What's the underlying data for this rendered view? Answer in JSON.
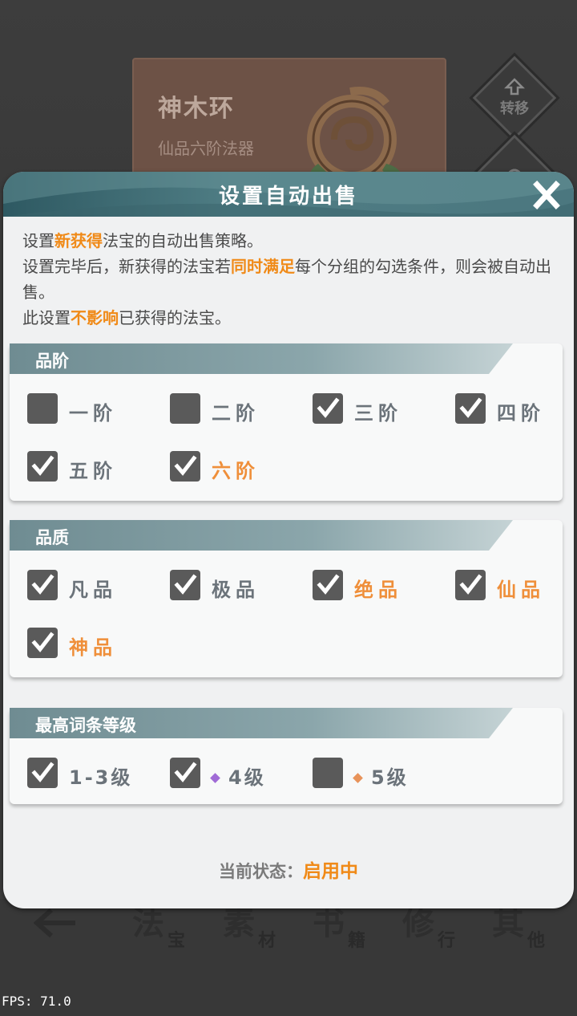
{
  "background": {
    "item_name": "神木环",
    "item_subtitle": "仙品六阶法器",
    "side_buttons": [
      {
        "label": "转移",
        "icon": "upload-icon"
      },
      {
        "label": "",
        "icon": "gear-icon"
      }
    ],
    "bottom_nav": [
      {
        "big": "法",
        "small": "宝"
      },
      {
        "big": "素",
        "small": "材"
      },
      {
        "big": "书",
        "small": "籍"
      },
      {
        "big": "修",
        "small": "行"
      },
      {
        "big": "其",
        "small": "他"
      }
    ],
    "fps_label": "FPS: 71.0"
  },
  "modal": {
    "title": "设置自动出售",
    "close_label": "X",
    "desc_line1": {
      "a": "设置",
      "hl": "新获得",
      "b": "法宝的自动出售策略。"
    },
    "desc_line2": {
      "a": "设置完毕后，新获得的法宝若",
      "hl": "同时满足",
      "b": "每个分组的勾选条件，则会被自动出售。"
    },
    "desc_line3": {
      "a": "此设置",
      "hl": "不影响",
      "b": "已获得的法宝。"
    }
  },
  "groups": {
    "tier": {
      "title": "品阶",
      "options": [
        {
          "label": "一阶",
          "checked": false,
          "orange": false
        },
        {
          "label": "二阶",
          "checked": false,
          "orange": false
        },
        {
          "label": "三阶",
          "checked": true,
          "orange": false
        },
        {
          "label": "四阶",
          "checked": true,
          "orange": false
        },
        {
          "label": "五阶",
          "checked": true,
          "orange": false
        },
        {
          "label": "六阶",
          "checked": true,
          "orange": true
        }
      ]
    },
    "quality": {
      "title": "品质",
      "options": [
        {
          "label": "凡品",
          "checked": true,
          "orange": false
        },
        {
          "label": "极品",
          "checked": true,
          "orange": false
        },
        {
          "label": "绝品",
          "checked": true,
          "orange": true
        },
        {
          "label": "仙品",
          "checked": true,
          "orange": true
        },
        {
          "label": "神品",
          "checked": true,
          "orange": true
        }
      ]
    },
    "affix": {
      "title": "最高词条等级",
      "options": [
        {
          "label": "1-3级",
          "checked": true,
          "diamond": ""
        },
        {
          "label": "4级",
          "checked": true,
          "diamond": "#a06bd6"
        },
        {
          "label": "5级",
          "checked": false,
          "diamond": "#e8935a"
        }
      ]
    }
  },
  "status": {
    "label": "当前状态：",
    "value": "启用中"
  },
  "colors": {
    "accent_orange": "#f08a18",
    "header_teal": "#4b777f",
    "checkbox_gray": "#5a5a5a"
  }
}
